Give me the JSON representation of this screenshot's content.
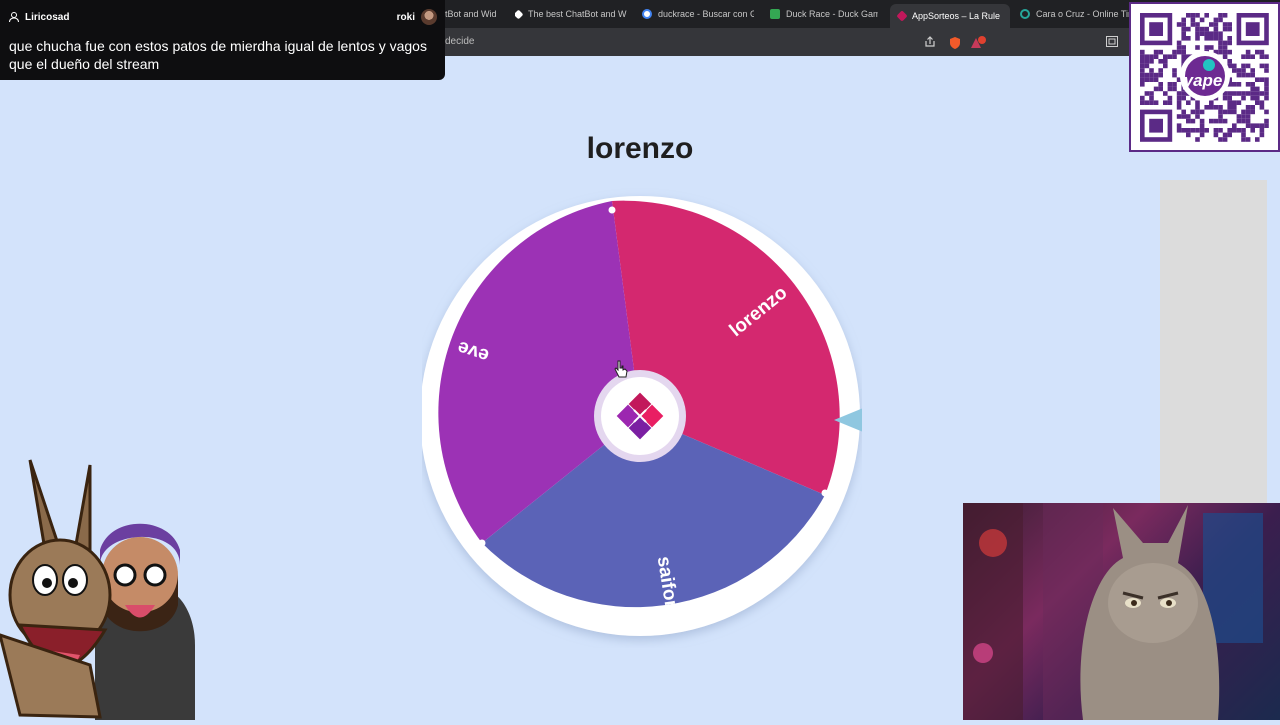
{
  "browser": {
    "tabs": [
      {
        "label": "tBot and Wid",
        "color": "#9aa0a6"
      },
      {
        "label": "The best ChatBot and Wid",
        "color": "#ffffff"
      },
      {
        "label": "duckrace - Buscar con Go",
        "color": "#4285f4"
      },
      {
        "label": "Duck Race - Duck Gam",
        "color": "#34a853"
      },
      {
        "label": "AppSorteos – La Rule",
        "color": "#c2185b",
        "active": true
      },
      {
        "label": "Cara o Cruz - Online Tira",
        "color": "#26a69a"
      }
    ],
    "address_text": "decide",
    "extension_badge": "1"
  },
  "chat": {
    "username": "Liricosad",
    "streamer": "roki",
    "message": "que chucha fue con estos patos de mierdha igual de lentos y vagos que el dueño del stream"
  },
  "wheel": {
    "winner": "lorenzo",
    "segments": [
      {
        "label": "lorenzo",
        "color": "#d4286f"
      },
      {
        "label": "saifon",
        "color": "#5b63b7"
      },
      {
        "label": "eve",
        "color": "#9c32b5"
      }
    ],
    "center_logo_color": "#c2185b",
    "pointer_color": "#8fc7e0"
  },
  "qr": {
    "brand": "yape",
    "brand_color": "#6d2a92"
  }
}
